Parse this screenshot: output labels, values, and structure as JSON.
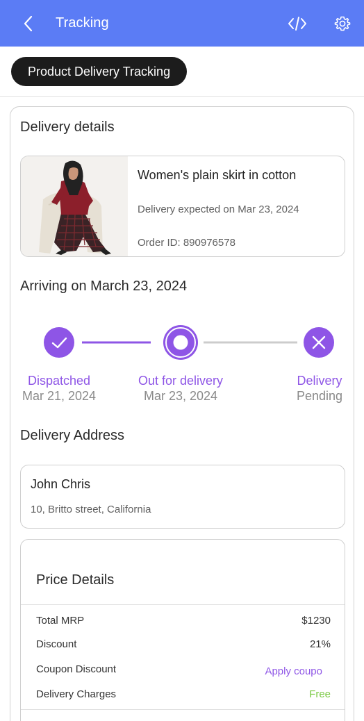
{
  "appbar": {
    "title": "Tracking",
    "back_icon": "chevron-left-icon",
    "code_icon": "code-icon",
    "settings_icon": "gear-icon",
    "color": "#5b7cf5"
  },
  "chip": {
    "label": "Product Delivery Tracking"
  },
  "delivery": {
    "heading": "Delivery details",
    "product": {
      "name": "Women's plain skirt in cotton",
      "expected": "Delivery expected on Mar 23, 2024",
      "order_id": "Order ID: 890976578"
    },
    "arriving": "Arriving on March 23, 2024"
  },
  "tracker": {
    "accent": "#8e55e6",
    "steps": [
      {
        "label": "Dispatched",
        "date": "Mar 21, 2024",
        "icon": "check-icon",
        "state": "done"
      },
      {
        "label": "Out for delivery",
        "date": "Mar 23, 2024",
        "icon": "current-dot-icon",
        "state": "current"
      },
      {
        "label": "Delivery",
        "date": "Pending",
        "icon": "close-icon",
        "state": "pending"
      }
    ]
  },
  "address": {
    "heading": "Delivery Address",
    "name": "John Chris",
    "line": "10, Britto street, California"
  },
  "price": {
    "heading": "Price Details",
    "rows": [
      {
        "label": "Total MRP",
        "value": "$1230"
      },
      {
        "label": "Discount",
        "value": "21%"
      },
      {
        "label": "Coupon Discount",
        "value": "Apply coupo"
      },
      {
        "label": "Delivery Charges",
        "value": "Free"
      }
    ]
  }
}
